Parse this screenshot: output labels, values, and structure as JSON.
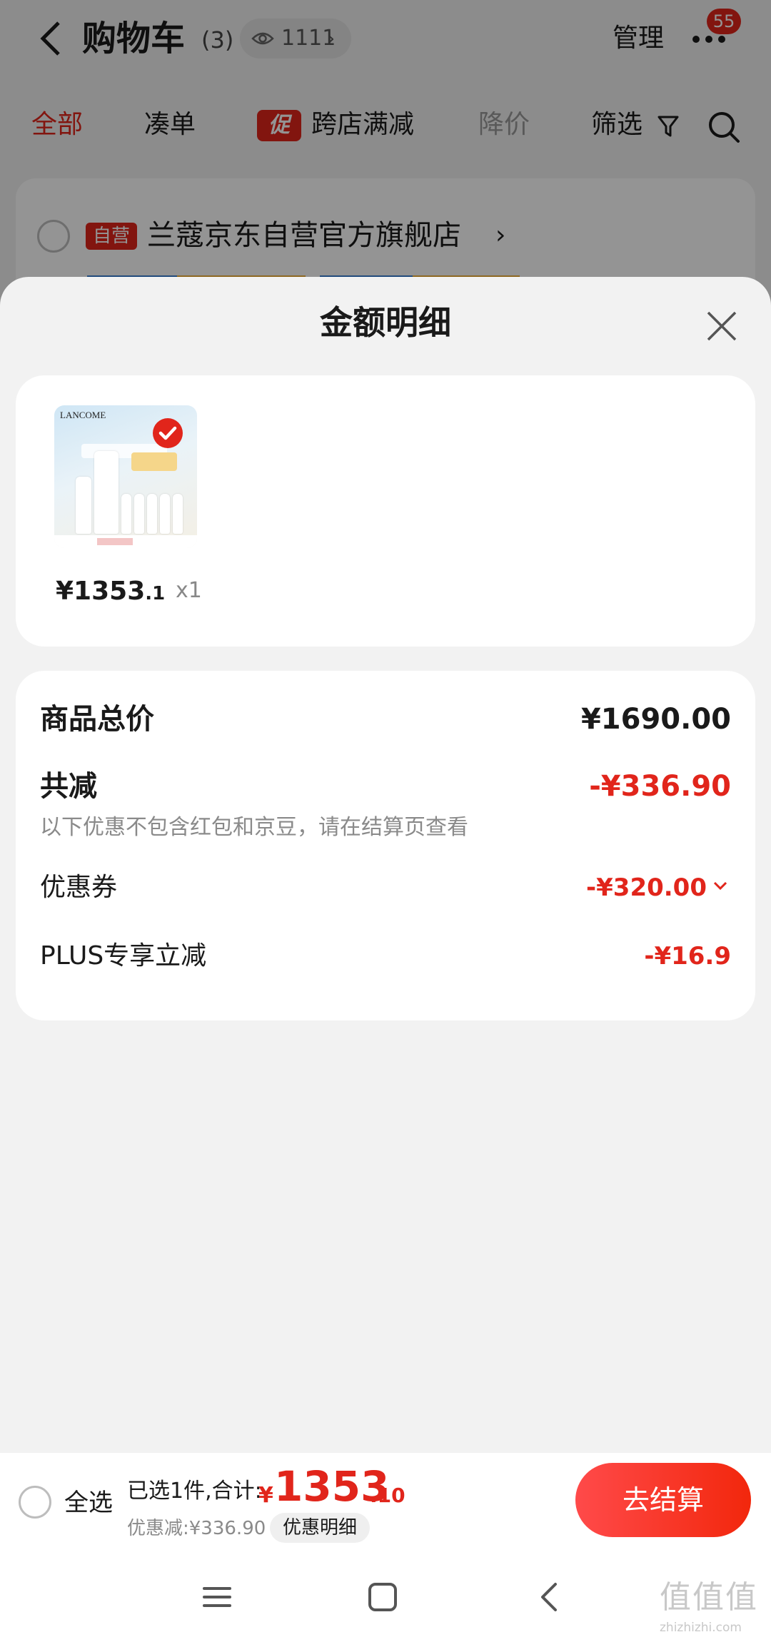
{
  "header": {
    "title": "购物车",
    "count": "(3)",
    "views": "1111",
    "manage": "管理",
    "badge": "55"
  },
  "filters": [
    {
      "label": "全部",
      "state": "active"
    },
    {
      "label": "凑单",
      "state": "normal"
    },
    {
      "label": "促",
      "state": "tag"
    },
    {
      "label": "跨店满减",
      "state": "normal"
    },
    {
      "label": "降价",
      "state": "disabled"
    },
    {
      "label": "筛选",
      "state": "normal"
    }
  ],
  "store": {
    "tag": "自营",
    "name": "兰蔻京东自营官方旗舰店"
  },
  "sheet": {
    "title": "金额明细",
    "product": {
      "image_brand": "LANCOME",
      "price_int": "¥1353",
      "price_dec": ".1",
      "quantity": "x1"
    },
    "rows": {
      "total_label": "商品总价",
      "total_value": "¥1690.00",
      "reduce_label": "共减",
      "reduce_value": "-¥336.90",
      "reduce_note": "以下优惠不包含红包和京豆，请在结算页查看",
      "coupon_label": "优惠券",
      "coupon_value": "-¥320.00",
      "plus_label": "PLUS专享立减",
      "plus_value": "-¥16.9"
    }
  },
  "checkout": {
    "select_all": "全选",
    "summary_label": "已选1件,合计:",
    "currency": "¥",
    "total_int": "1353",
    "total_dec": ".10",
    "discount": "优惠减:¥336.90",
    "detail_button": "优惠明细",
    "checkout_button": "去结算"
  },
  "watermark": {
    "glyphs": "值值值",
    "site": "zhizhizhi.com"
  },
  "colors": {
    "accent": "#e1251b",
    "sheet_bg": "#f2f2f2",
    "card_bg": "#ffffff"
  }
}
